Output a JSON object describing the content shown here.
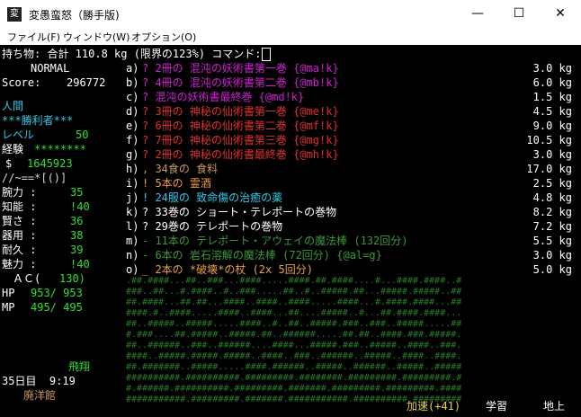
{
  "window": {
    "title": "変愚蛮怒（勝手版)",
    "icon_glyph": "変",
    "minimize": "—",
    "maximize": "☐",
    "close": "✕"
  },
  "menu": [
    "ファイル(F)",
    "ウィンドウ(W)",
    "オプション(O)"
  ],
  "header": {
    "text": "持ち物: 合計 110.8 kg (限界の123%) コマンド:"
  },
  "sidebar": {
    "mode": "NORMAL",
    "score_label": "Score:",
    "score_value": "296772",
    "race": "人間",
    "title": "***勝利者***",
    "level_label": "レベル",
    "level_value": "50",
    "exp_label": "経験",
    "exp_value": "********",
    "gold_label": "$",
    "gold_value": "1645923",
    "equip_line": "//~==*[()]",
    "stats": [
      {
        "label": "腕力 :",
        "value": "35"
      },
      {
        "label": "知能 :",
        "value": "!40"
      },
      {
        "label": "賢さ :",
        "value": "36"
      },
      {
        "label": "器用 :",
        "value": "38"
      },
      {
        "label": "耐久 :",
        "value": "39"
      },
      {
        "label": "魅力 :",
        "value": "!40"
      }
    ],
    "ac_label": "ＡＣ(",
    "ac_value": "130)",
    "hp_label": "HP",
    "hp_value": "953/ 953",
    "mp_label": "MP",
    "mp_value": "495/ 495",
    "status_flying": "飛翔",
    "day_time": "35日目  9:19",
    "location": "廃洋館"
  },
  "inventory": [
    {
      "slot": "a)",
      "text": "? 2冊の 混沌の妖術書第一巻 {@ma!k}",
      "weight": "3.0 kg",
      "color": "#d020d0"
    },
    {
      "slot": "b)",
      "text": "? 4冊の 混沌の妖術書第二巻 {@mb!k}",
      "weight": "6.0 kg",
      "color": "#d020d0"
    },
    {
      "slot": "c)",
      "text": "? 混沌の妖術書最終巻 {@md!k}",
      "weight": "1.5 kg",
      "color": "#d020d0"
    },
    {
      "slot": "d)",
      "text": "? 3冊の 神秘の仙術書第一巻 {@me!k}",
      "weight": "4.5 kg",
      "color": "#e03030"
    },
    {
      "slot": "e)",
      "text": "? 6冊の 神秘の仙術書第二巻 {@mf!k}",
      "weight": "9.0 kg",
      "color": "#e03030"
    },
    {
      "slot": "f)",
      "text": "? 7冊の 神秘の仙術書第三巻 {@mg!k}",
      "weight": "10.5 kg",
      "color": "#e03030"
    },
    {
      "slot": "g)",
      "text": "? 2冊の 神秘の仙術書最終巻 {@mh!k}",
      "weight": "3.0 kg",
      "color": "#e03030"
    },
    {
      "slot": "h)",
      "text": ", 34食の 食料",
      "weight": "17.0 kg",
      "color": "#c89860"
    },
    {
      "slot": "i)",
      "text": "! 5本の 霊酒",
      "weight": "2.5 kg",
      "color": "#e8a040"
    },
    {
      "slot": "j)",
      "text": "! 24服の 致命傷の治癒の薬",
      "weight": "4.8 kg",
      "color": "#30c8e8"
    },
    {
      "slot": "k)",
      "text": "? 33巻の ショート・テレポートの巻物",
      "weight": "8.2 kg",
      "color": "#ffffff"
    },
    {
      "slot": "l)",
      "text": "? 29巻の テレポートの巻物",
      "weight": "7.2 kg",
      "color": "#ffffff"
    },
    {
      "slot": "m)",
      "text": "- 11本の テレポート・アウェイの魔法棒 (132回分)",
      "weight": "5.5 kg",
      "color": "#3a9a3a"
    },
    {
      "slot": "n)",
      "text": "- 6本の 岩石溶解の魔法棒 (72回分) {@al=g}",
      "weight": "3.0 kg",
      "color": "#3a9a3a"
    },
    {
      "slot": "o)",
      "text": "_ 2本の *破壊*の杖 (2x 5回分)",
      "weight": "5.0 kg",
      "color": "#e8a040"
    }
  ],
  "map_rows": [
    ".##.####...##..###...####.....####.##.####....#...####.####..#",
    "###..##...#.####..#..###.....##..#..#####.##...#####.#####..##",
    "##.####...##.##...####..####..####.....####...#.####.####...##",
    "####.#..####.....####..####...##....#####..#...##.####.####...",
    "##..#####..#####.....####..#..##..#####.###..###..#####.....##",
    "#.###....##.#####..#####.##..######.....##.##..####.###.#####.",
    "##..######..###..######....####...#####.###..#####..####..###.",
    "####..#####.#####.#####..####..###..######..#####..####..####.",
    "##.#######..#####.....####.######..#####..######..#####..#####",
    "##########.##########.#########.########.#########.#########.#",
    "#.######.##########.#########.#######.#########.#########.####",
    "###########.#########.#######.###########.##########.#########"
  ],
  "bottom_status": {
    "speed": "加速(+41)",
    "study": "学習",
    "depth": "地上"
  }
}
